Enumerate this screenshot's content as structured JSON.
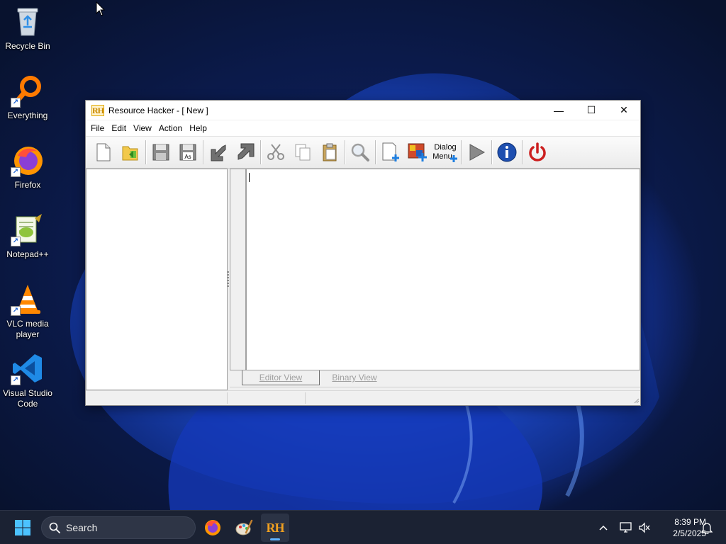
{
  "desktop": {
    "icons": [
      {
        "label": "Recycle Bin"
      },
      {
        "label": "Everything"
      },
      {
        "label": "Firefox"
      },
      {
        "label": "Notepad++"
      },
      {
        "label": "VLC media player"
      },
      {
        "label": "Visual Studio Code"
      }
    ]
  },
  "window": {
    "title": "Resource Hacker - [ New ]",
    "logo_text": "RH",
    "controls": {
      "minimize": "—",
      "maximize": "☐",
      "close": "✕"
    },
    "menu": [
      "File",
      "Edit",
      "View",
      "Action",
      "Help"
    ],
    "toolbar": {
      "dialog_menu_label_line1": "Dialog",
      "dialog_menu_label_line2": "Menu"
    },
    "tabs": {
      "editor": "Editor View",
      "binary": "Binary View"
    }
  },
  "taskbar": {
    "search_placeholder": "Search",
    "clock_time": "8:39 PM",
    "clock_date": "2/5/2025",
    "tray_app_label": "RH"
  },
  "colors": {
    "accent": "#5fb2ff",
    "close_red": "#cc1f1f",
    "info_blue": "#1e4fb0"
  }
}
